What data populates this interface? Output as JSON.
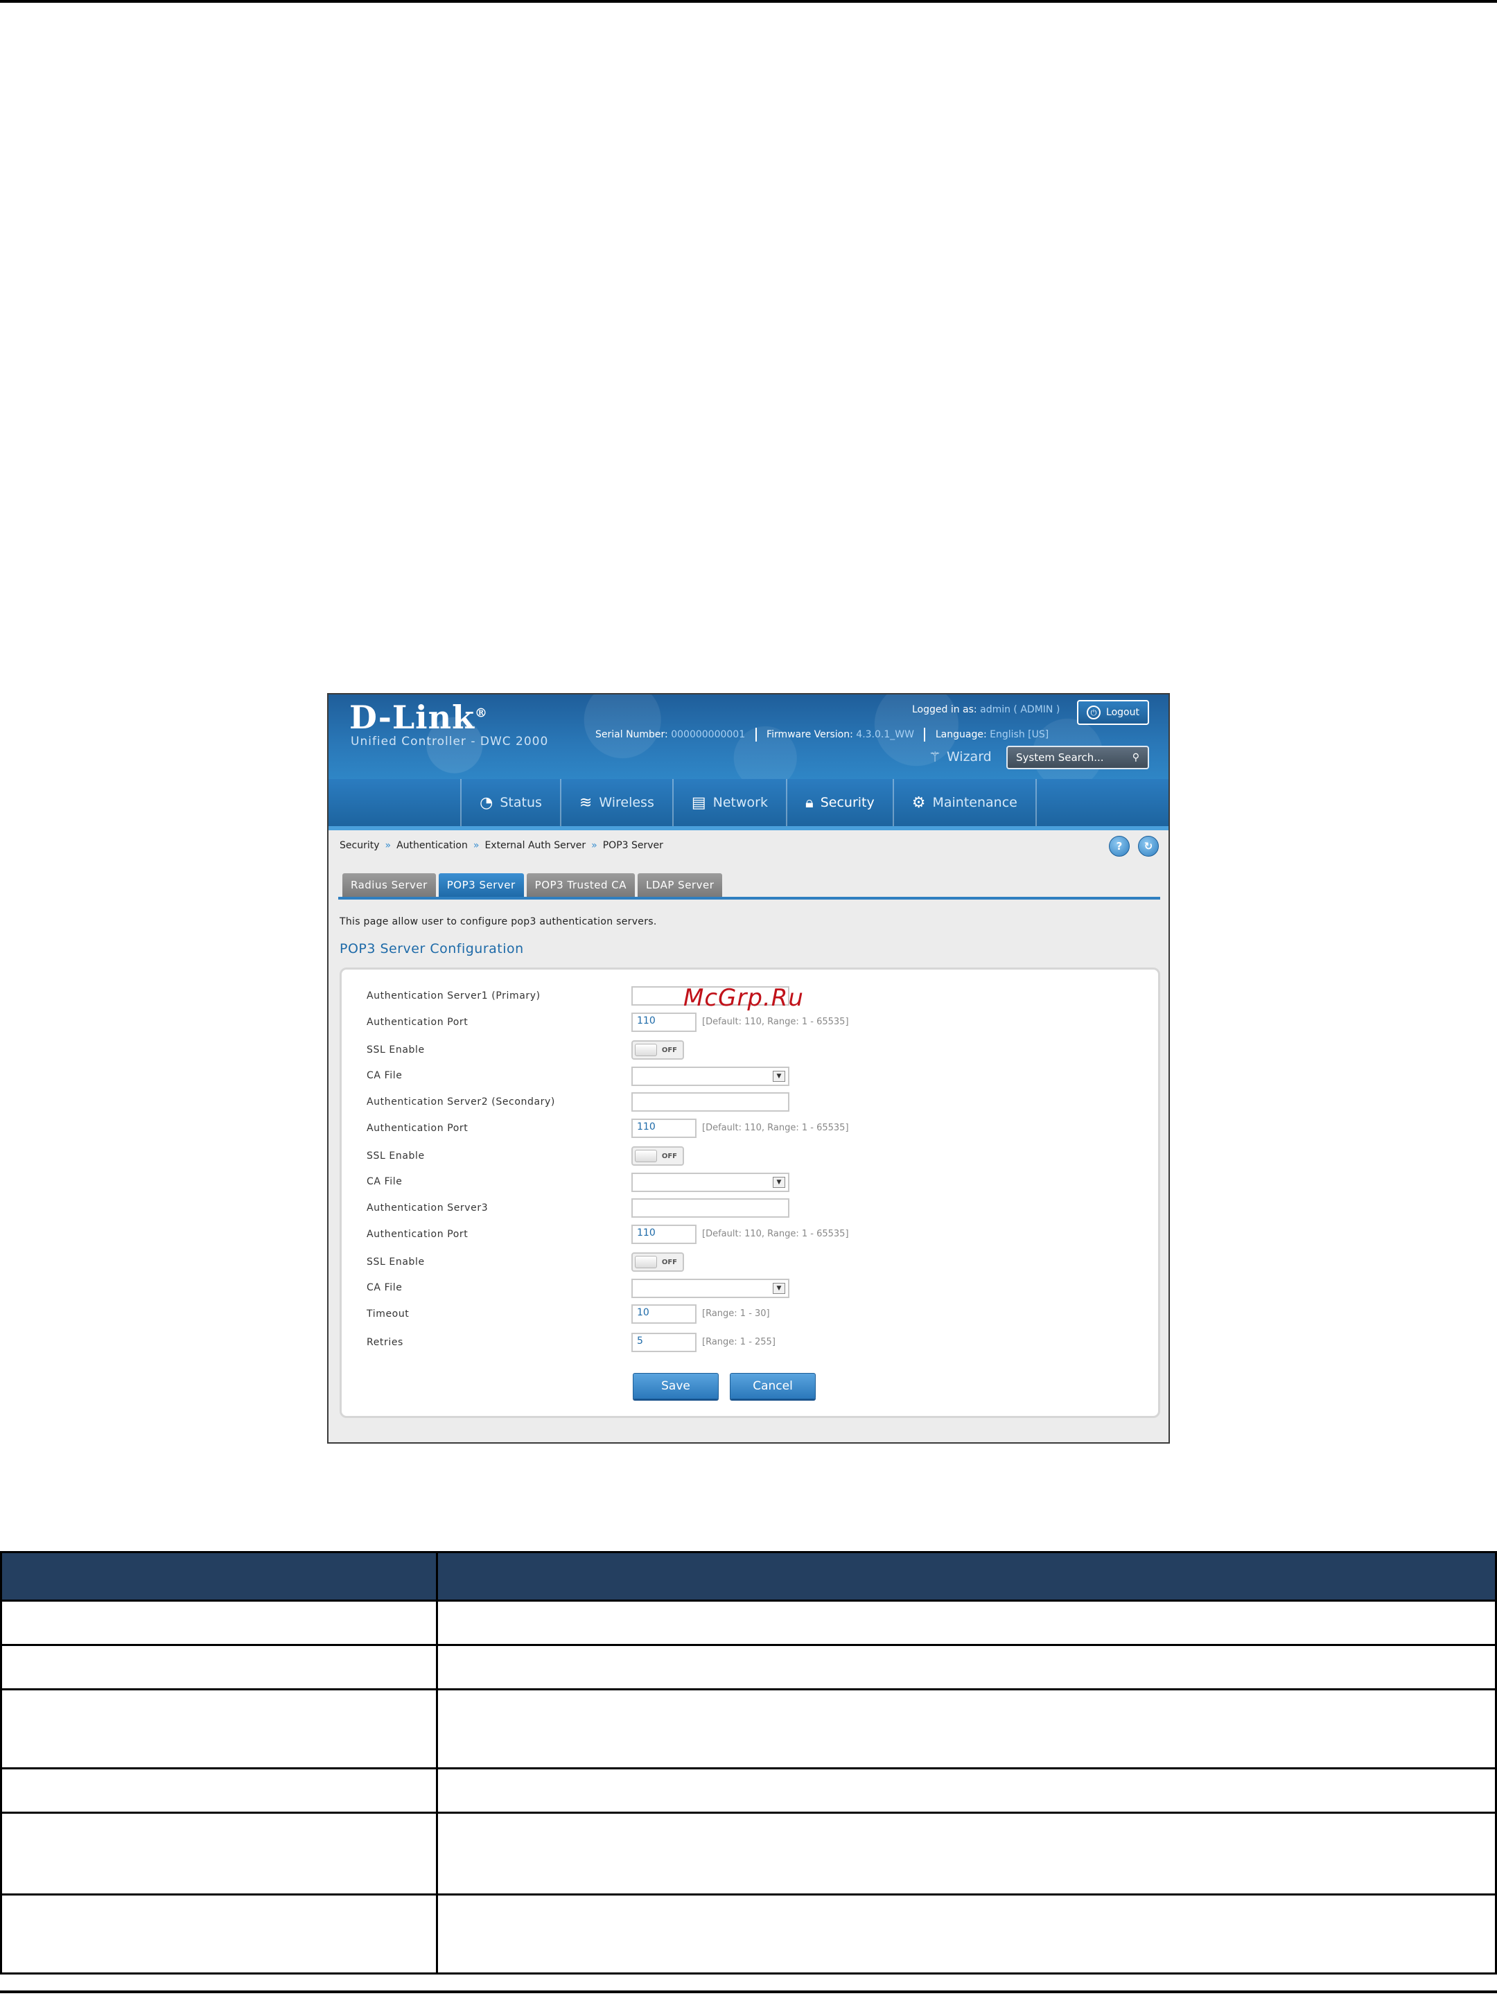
{
  "app": {
    "brand": "D-Link",
    "brand_mark": "®",
    "product": "Unified Controller - DWC 2000",
    "serial_label": "Serial Number:",
    "serial_value": "000000000001",
    "firmware_label": "Firmware Version:",
    "firmware_value": "4.3.0.1_WW",
    "language_label": "Language:",
    "language_value": "English [US]",
    "logged_in_label": "Logged in as:",
    "logged_in_value": "admin ( ADMIN )",
    "logout_label": "Logout",
    "wizard_label": "Wizard",
    "search_placeholder": "System Search..."
  },
  "nav": {
    "items": [
      {
        "label": "Status",
        "icon": "gauge-icon"
      },
      {
        "label": "Wireless",
        "icon": "wifi-icon"
      },
      {
        "label": "Network",
        "icon": "server-icon"
      },
      {
        "label": "Security",
        "icon": "lock-icon"
      },
      {
        "label": "Maintenance",
        "icon": "gears-icon"
      }
    ],
    "active": "Security"
  },
  "breadcrumb": [
    "Security",
    "Authentication",
    "External Auth Server",
    "POP3 Server"
  ],
  "tabs": [
    {
      "label": "Radius Server"
    },
    {
      "label": "POP3 Server"
    },
    {
      "label": "POP3 Trusted CA"
    },
    {
      "label": "LDAP Server"
    }
  ],
  "active_tab": "POP3 Server",
  "intro": "This page allow user to configure pop3 authentication servers.",
  "section_title": "POP3 Server Configuration",
  "form": {
    "server1_label": "Authentication Server1 (Primary)",
    "server1_value": "",
    "port_label": "Authentication Port",
    "port1_value": "110",
    "port_hint": "[Default: 110, Range: 1 - 65535]",
    "ssl_label": "SSL Enable",
    "ssl_state": "OFF",
    "ca_label": "CA File",
    "server2_label": "Authentication Server2 (Secondary)",
    "server2_value": "",
    "port2_value": "110",
    "server3_label": "Authentication Server3",
    "server3_value": "",
    "port3_value": "110",
    "timeout_label": "Timeout",
    "timeout_value": "10",
    "timeout_hint": "[Range: 1 - 30]",
    "retries_label": "Retries",
    "retries_value": "5",
    "retries_hint": "[Range: 1 - 255]",
    "save_label": "Save",
    "cancel_label": "Cancel"
  },
  "watermark": "McGrp.Ru",
  "colors": {
    "header_blue": "#2a78b8",
    "accent_blue": "#1d6aa8",
    "table_header": "#243f60",
    "watermark_red": "#c0121a"
  }
}
